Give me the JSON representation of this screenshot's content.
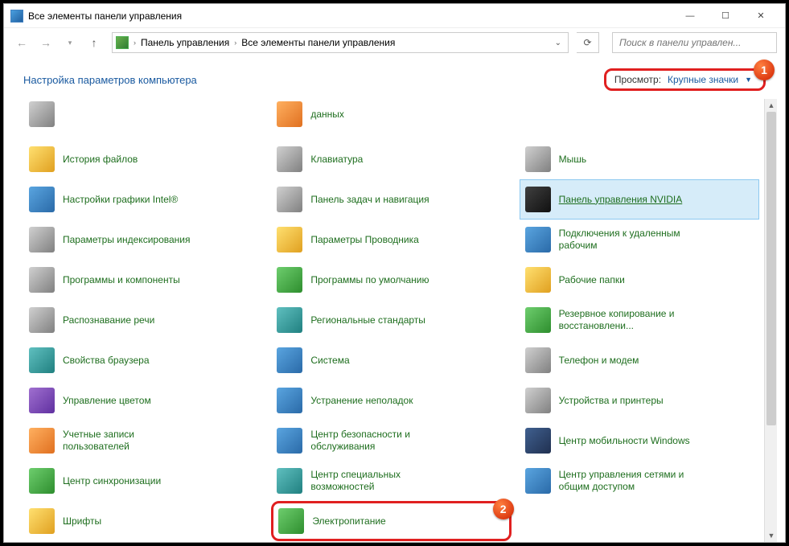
{
  "titlebar": {
    "title": "Все элементы панели управления"
  },
  "nav": {
    "breadcrumb1": "Панель управления",
    "breadcrumb2": "Все элементы панели управления",
    "search_placeholder": "Поиск в панели управлен..."
  },
  "header": {
    "title": "Настройка параметров компьютера",
    "view_label": "Просмотр:",
    "view_value": "Крупные значки"
  },
  "annotations": {
    "badge1": "1",
    "badge2": "2"
  },
  "items": [
    {
      "label": "",
      "icon": "c-grey"
    },
    {
      "label": "данных",
      "icon": "c-orange"
    },
    {
      "label": "",
      "icon": ""
    },
    {
      "label": "История файлов",
      "icon": "c-yellow"
    },
    {
      "label": "Клавиатура",
      "icon": "c-grey"
    },
    {
      "label": "Мышь",
      "icon": "c-grey"
    },
    {
      "label": "Настройки графики Intel®",
      "icon": "c-blue"
    },
    {
      "label": "Панель задач и навигация",
      "icon": "c-grey"
    },
    {
      "label": "Панель управления NVIDIA",
      "icon": "c-dark",
      "selected": true
    },
    {
      "label": "Параметры индексирования",
      "icon": "c-grey"
    },
    {
      "label": "Параметры Проводника",
      "icon": "c-yellow"
    },
    {
      "label": "Подключения к удаленным рабочим",
      "icon": "c-blue"
    },
    {
      "label": "Программы и компоненты",
      "icon": "c-grey"
    },
    {
      "label": "Программы по умолчанию",
      "icon": "c-green"
    },
    {
      "label": "Рабочие папки",
      "icon": "c-yellow"
    },
    {
      "label": "Распознавание речи",
      "icon": "c-grey"
    },
    {
      "label": "Региональные стандарты",
      "icon": "c-teal"
    },
    {
      "label": "Резервное копирование и восстановлени...",
      "icon": "c-green"
    },
    {
      "label": "Свойства браузера",
      "icon": "c-teal"
    },
    {
      "label": "Система",
      "icon": "c-blue"
    },
    {
      "label": "Телефон и модем",
      "icon": "c-grey"
    },
    {
      "label": "Управление цветом",
      "icon": "c-purple"
    },
    {
      "label": "Устранение неполадок",
      "icon": "c-blue"
    },
    {
      "label": "Устройства и принтеры",
      "icon": "c-grey"
    },
    {
      "label": "Учетные записи пользователей",
      "icon": "c-orange"
    },
    {
      "label": "Центр безопасности и обслуживания",
      "icon": "c-blue"
    },
    {
      "label": "Центр мобильности Windows",
      "icon": "c-navy"
    },
    {
      "label": "Центр синхронизации",
      "icon": "c-green"
    },
    {
      "label": "Центр специальных возможностей",
      "icon": "c-teal"
    },
    {
      "label": "Центр управления сетями и общим доступом",
      "icon": "c-blue"
    },
    {
      "label": "Шрифты",
      "icon": "c-yellow"
    },
    {
      "label": "Электропитание",
      "icon": "c-green",
      "highlight": true
    },
    {
      "label": "",
      "icon": ""
    }
  ]
}
